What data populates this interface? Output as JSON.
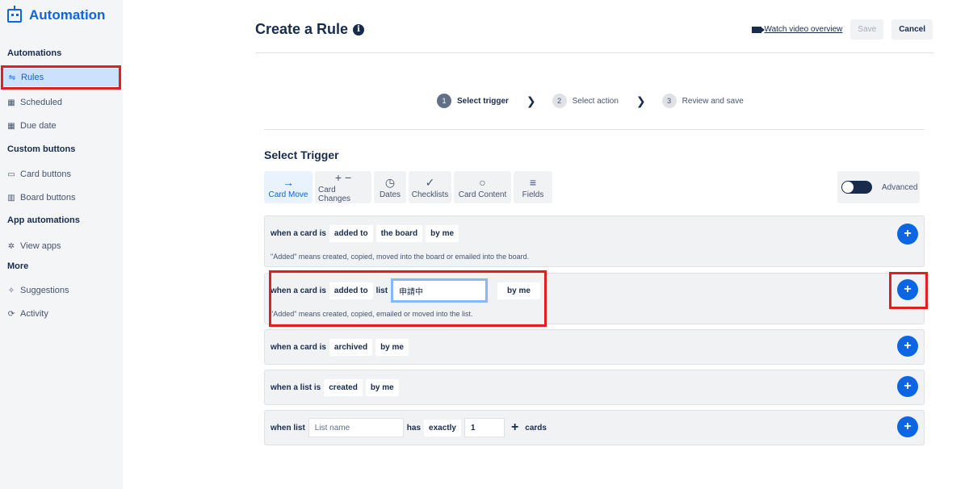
{
  "sidebar": {
    "brand": "Automation",
    "sections": {
      "automations": "Automations",
      "custom_buttons": "Custom buttons",
      "app_automations": "App automations",
      "more": "More"
    },
    "items": {
      "rules": "Rules",
      "scheduled": "Scheduled",
      "due_date": "Due date",
      "card_buttons": "Card buttons",
      "board_buttons": "Board buttons",
      "view_apps": "View apps",
      "suggestions": "Suggestions",
      "activity": "Activity"
    },
    "active_item": "Rules"
  },
  "header": {
    "title": "Create a Rule",
    "watch_link": "Watch video overview",
    "save_label": "Save",
    "cancel_label": "Cancel"
  },
  "steps": [
    {
      "num": "1",
      "label": "Select trigger",
      "current": true
    },
    {
      "num": "2",
      "label": "Select action",
      "current": false
    },
    {
      "num": "3",
      "label": "Review and save",
      "current": false
    }
  ],
  "select_trigger": {
    "title": "Select Trigger",
    "tabs": [
      {
        "label": "Card Move",
        "icon": "arrow-right-icon",
        "active": true
      },
      {
        "label": "Card Changes",
        "icon": "plus-minus-icon",
        "active": false
      },
      {
        "label": "Dates",
        "icon": "clock-icon",
        "active": false
      },
      {
        "label": "Checklists",
        "icon": "check-icon",
        "active": false
      },
      {
        "label": "Card Content",
        "icon": "comment-icon",
        "active": false
      },
      {
        "label": "Fields",
        "icon": "lines-icon",
        "active": false
      }
    ],
    "advanced_label": "Advanced"
  },
  "triggers": {
    "t1": {
      "prefix": "when a card is",
      "action": "added to",
      "target": "the board",
      "by": "by me",
      "description": "\"Added\" means created, copied, moved into the board or emailed into the board."
    },
    "t2": {
      "prefix": "when a card is",
      "action": "added to",
      "list_word": "list",
      "list_value": "申請中",
      "by": "by me",
      "description": "\"Added\" means created, copied, emailed or moved into the list."
    },
    "t3": {
      "prefix": "when a card is",
      "action": "archived",
      "by": "by me"
    },
    "t4": {
      "prefix": "when a list is",
      "action": "created",
      "by": "by me"
    },
    "t5": {
      "prefix": "when list",
      "list_placeholder": "List name",
      "has": "has",
      "comparator": "exactly",
      "count": "1",
      "suffix": "cards"
    }
  },
  "colors": {
    "accent": "#0c66e4",
    "highlight": "#e02020",
    "sidebar_bg": "#f4f5f7"
  }
}
